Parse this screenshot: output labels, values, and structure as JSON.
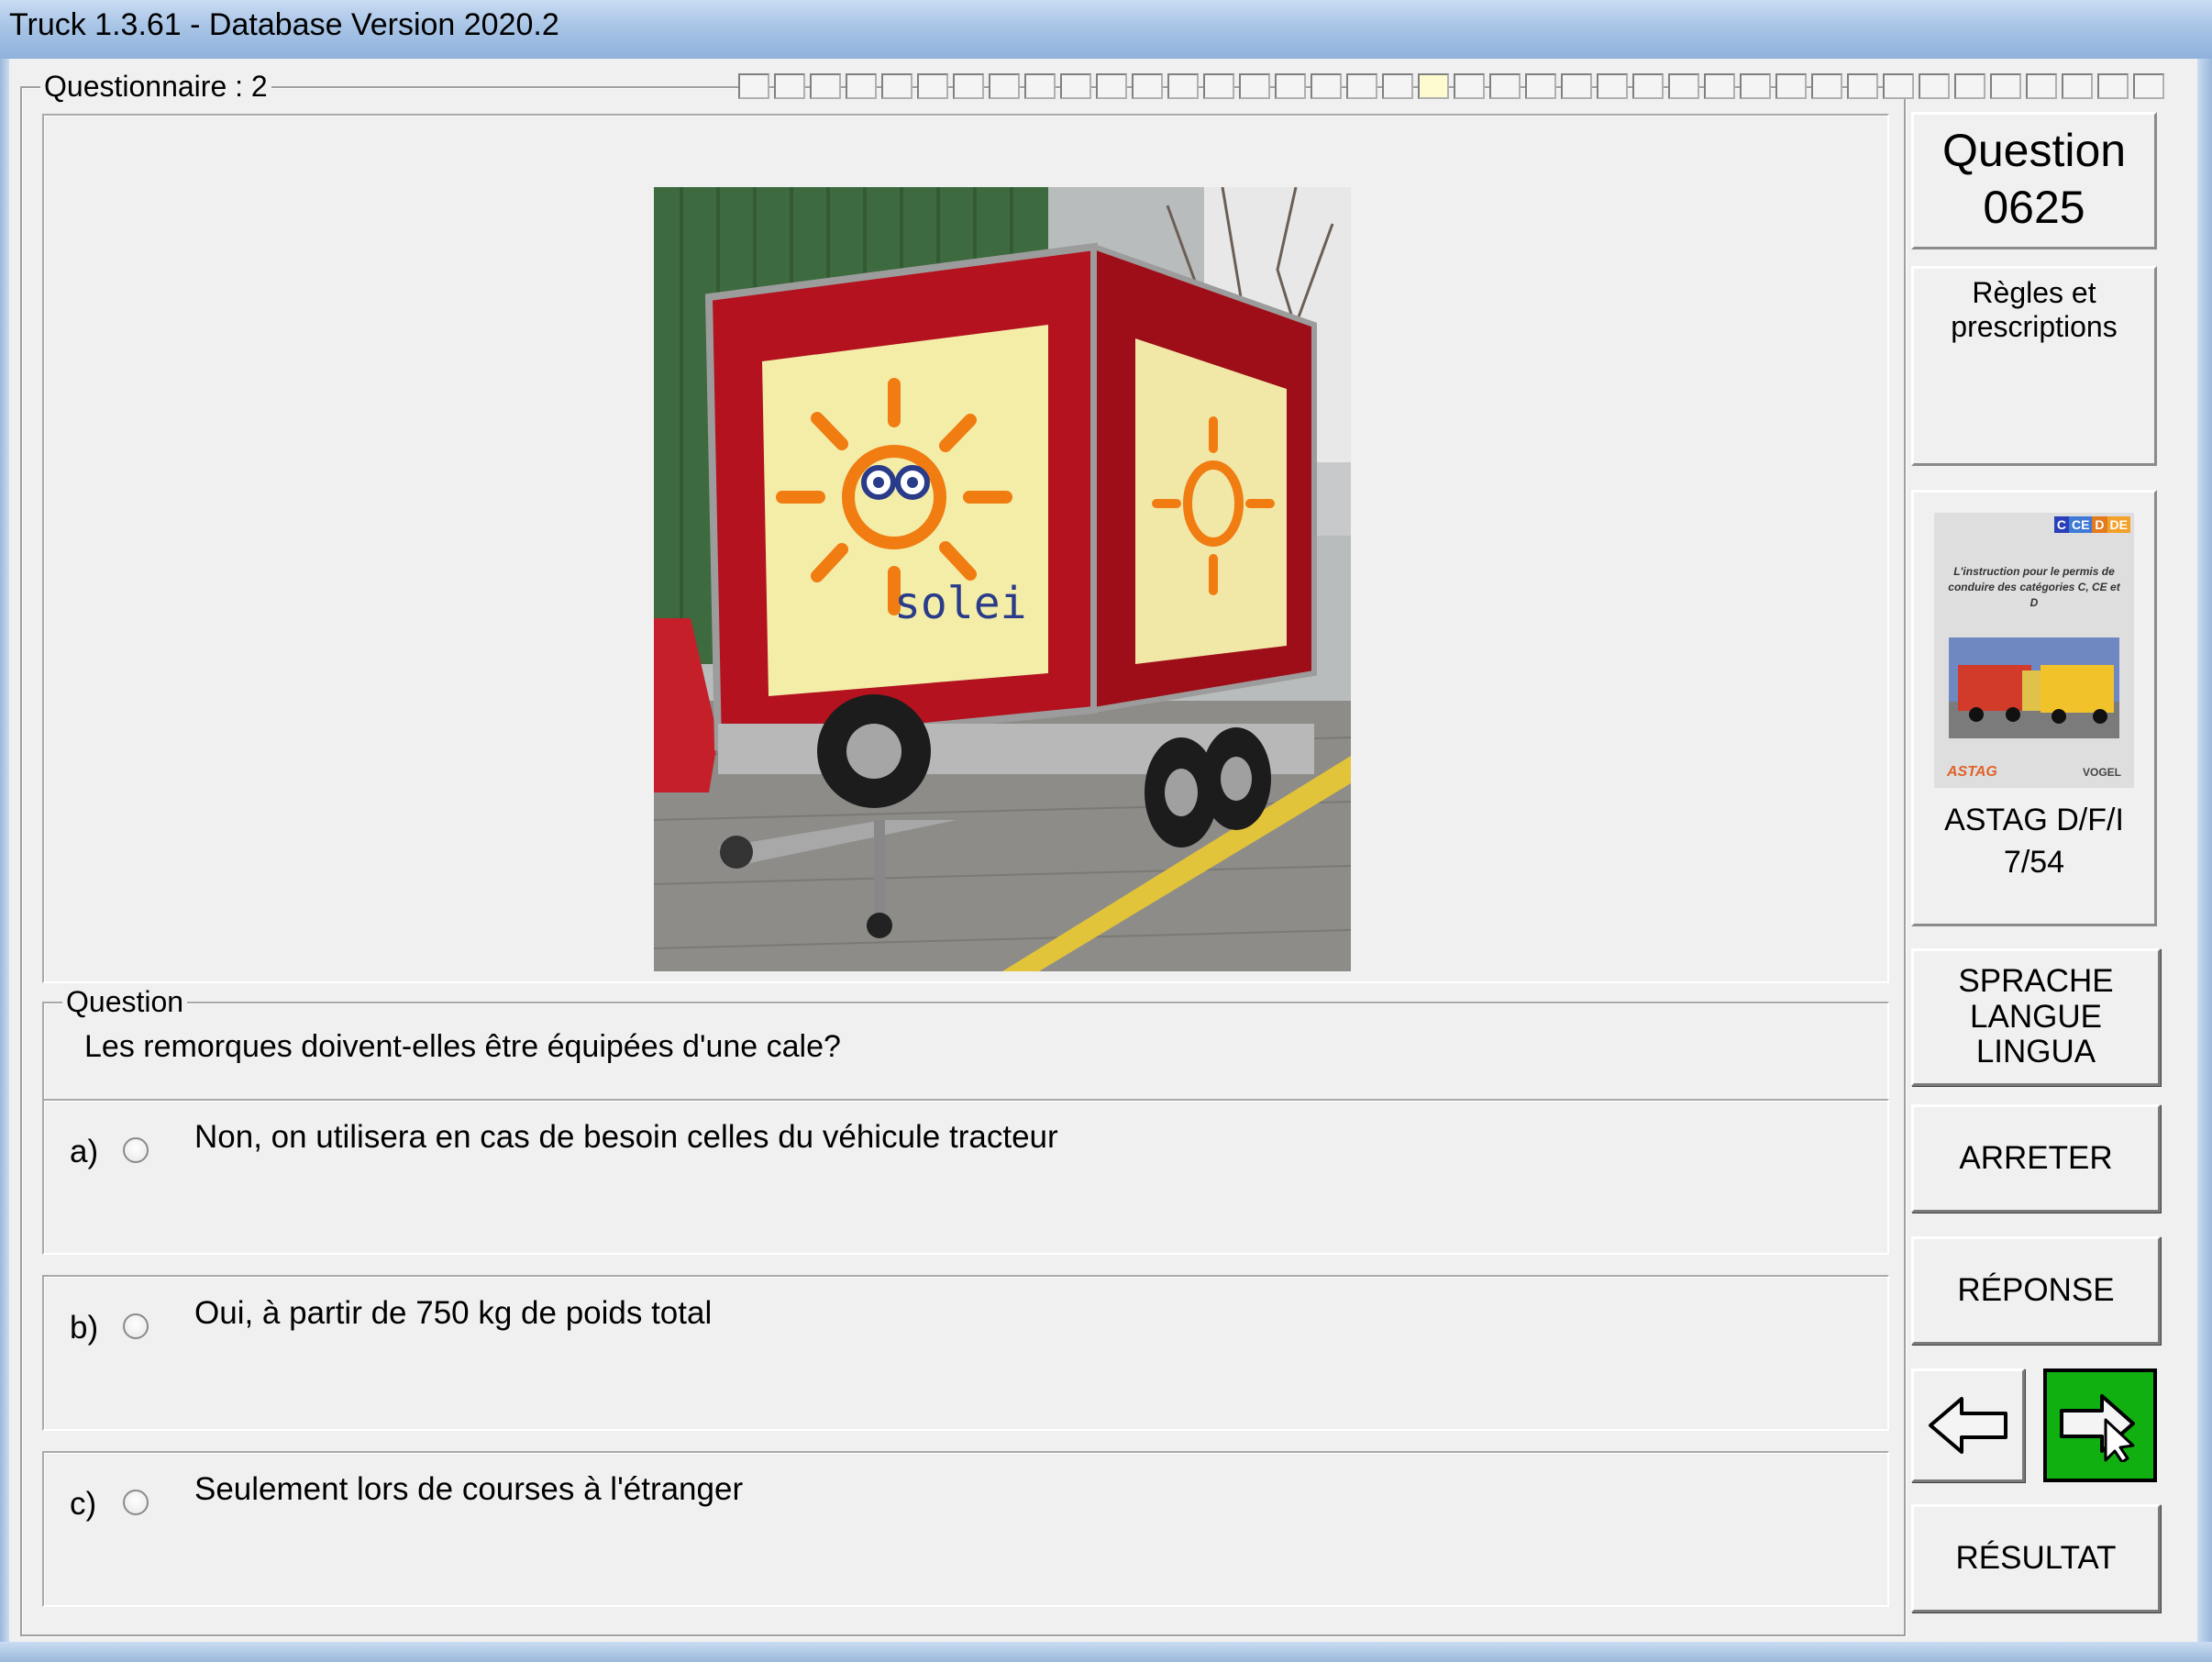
{
  "window": {
    "title": "Truck 1.3.61 - Database Version 2020.2"
  },
  "questionnaire": {
    "label": "Questionnaire : 2",
    "progress_total": 40,
    "progress_current": 20
  },
  "image": {
    "alt": "Remorque fourgon rouge avec inscription",
    "brand_text": "solei"
  },
  "question": {
    "label": "Question",
    "text": "Les remorques doivent-elles être équipées d'une cale?"
  },
  "answers": [
    {
      "letter": "a)",
      "text": "Non, on utilisera en cas de besoin celles du véhicule tracteur"
    },
    {
      "letter": "b)",
      "text": "Oui, à partir de 750 kg de poids total"
    },
    {
      "letter": "c)",
      "text": "Seulement lors de courses à l'étranger"
    }
  ],
  "sidebar": {
    "question_title": "Question",
    "question_number": "0625",
    "category_line1": "Règles et",
    "category_line2": "prescriptions",
    "book": {
      "badges": [
        "C",
        "CE",
        "D",
        "DE"
      ],
      "cover_text": "L'instruction pour le permis de conduire des catégories C, CE et D",
      "logo_left": "ASTAG",
      "logo_right": "VOGEL",
      "source": "ASTAG D/F/I",
      "page": "7/54"
    },
    "language_button": [
      "SPRACHE",
      "LANGUE",
      "LINGUA"
    ],
    "stop_button": "ARRETER",
    "answer_button": "RÉPONSE",
    "result_button": "RÉSULTAT"
  },
  "colors": {
    "next_button": "#10b010",
    "trailer_red": "#b3121e",
    "sun_orange": "#f07c12"
  }
}
